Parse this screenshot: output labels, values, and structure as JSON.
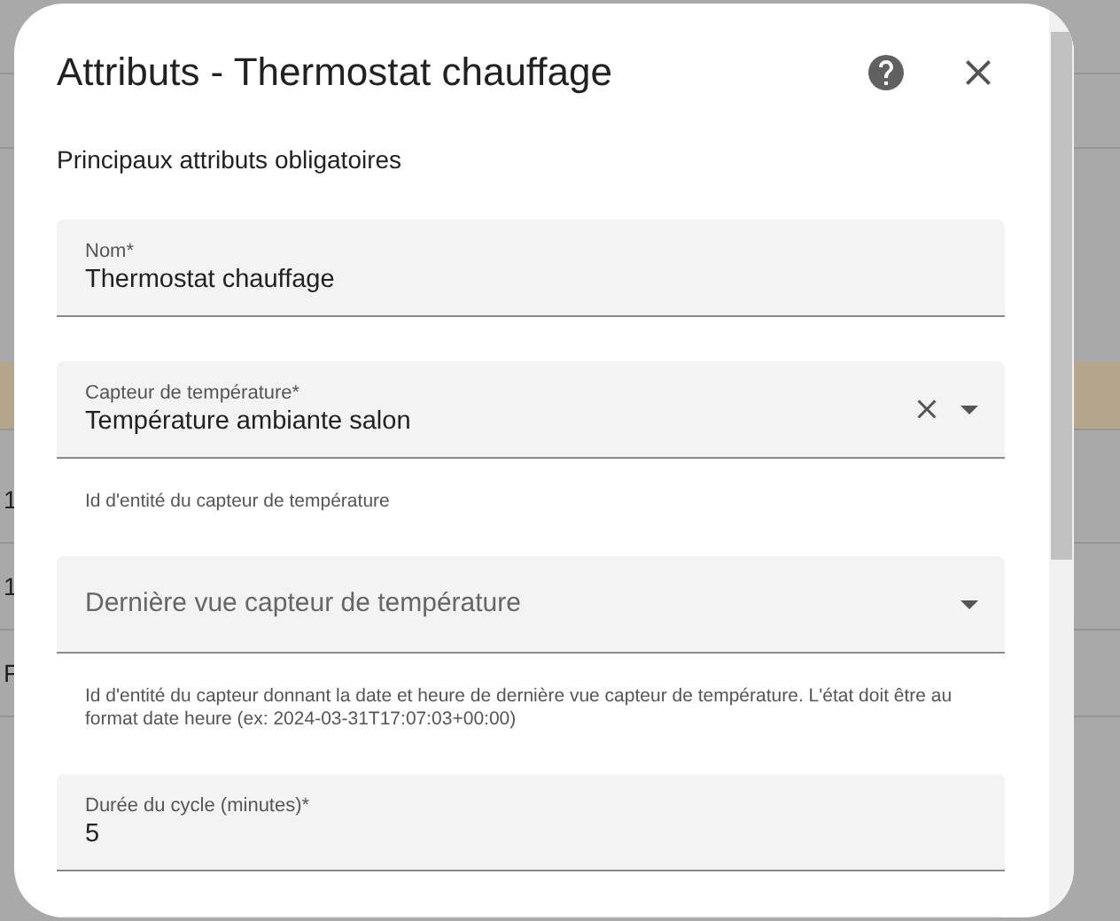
{
  "background": {
    "rows": [
      {
        "selected": true
      },
      {
        "text": "1",
        "selected": false
      },
      {
        "text": "1",
        "selected": false
      },
      {
        "text": "F",
        "selected": false
      }
    ]
  },
  "dialog": {
    "title": "Attributs - Thermostat chauffage",
    "subtitle": "Principaux attributs obligatoires",
    "fields": [
      {
        "kind": "text",
        "label": "Nom*",
        "value": "Thermostat chauffage"
      },
      {
        "kind": "select",
        "label": "Capteur de température*",
        "value": "Température ambiante salon",
        "clearable": true,
        "helper": "Id d'entité du capteur de température"
      },
      {
        "kind": "select",
        "label": "Dernière vue capteur de température",
        "helper": "Id d'entité du capteur donnant la date et heure de dernière vue capteur de température. L'état doit être au format date heure (ex: 2024-03-31T17:07:03+00:00)"
      },
      {
        "kind": "text",
        "label": "Durée du cycle (minutes)*",
        "value": "5"
      }
    ]
  }
}
